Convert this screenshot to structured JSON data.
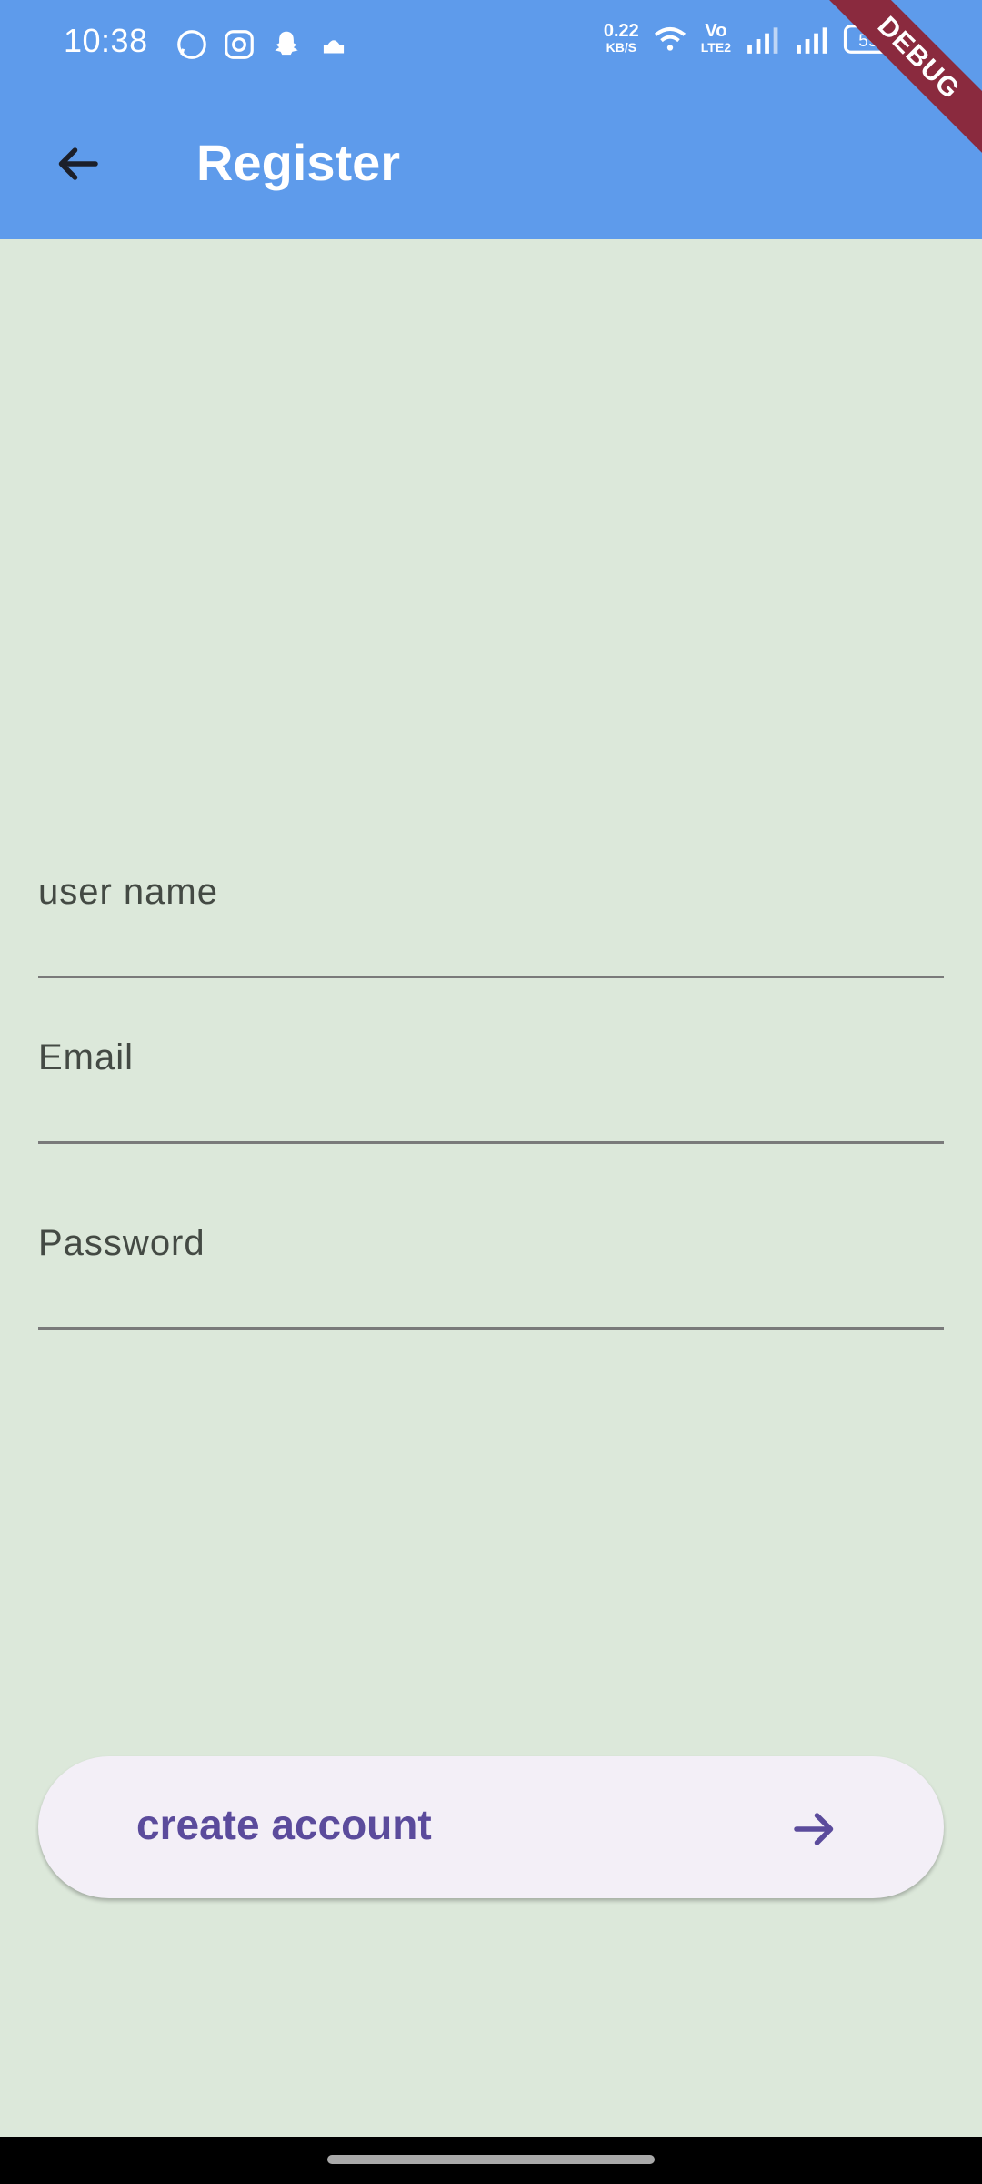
{
  "status_bar": {
    "time": "10:38",
    "network_speed_value": "0.22",
    "network_speed_unit": "KB/S",
    "volte_label_top": "Vo",
    "volte_label_bottom": "LTE2",
    "battery_text": "59",
    "icons": [
      "whatsapp-icon",
      "instagram-icon",
      "snapchat-icon",
      "prayer-app-icon",
      "wifi-icon",
      "signal-icon",
      "signal-icon",
      "battery-icon"
    ]
  },
  "debug_banner": "DEBUG",
  "appbar": {
    "title": "Register",
    "back_icon": "arrow-back-icon",
    "background": "#5e9beb"
  },
  "form": {
    "username_label": "user name",
    "email_label": "Email",
    "password_label": "Password"
  },
  "cta": {
    "label": "create account",
    "icon": "arrow-forward-icon",
    "text_color": "#5b4b9c",
    "background": "#f3eff7"
  },
  "colors": {
    "page_background": "#dce8da",
    "underline": "#7a7a7a"
  }
}
